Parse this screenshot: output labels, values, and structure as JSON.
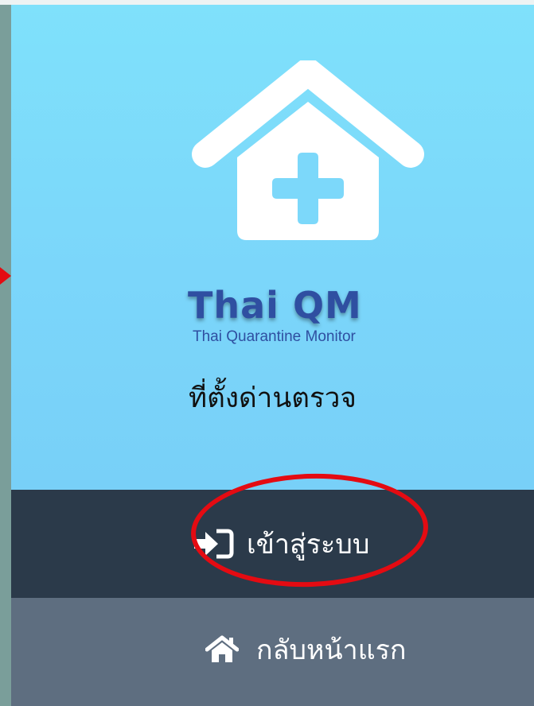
{
  "logo": {
    "title": "Thai QM",
    "subtitle": "Thai Quarantine Monitor"
  },
  "header": {
    "location_label": "ที่ตั้งด่านตรวจ"
  },
  "menu": {
    "login_label": "เข้าสู่ระบบ",
    "home_label": "กลับหน้าแรก"
  },
  "icons": {
    "header_icon": "house-medical-cross-icon",
    "login_icon": "sign-in-icon",
    "home_icon": "home-icon"
  },
  "colors": {
    "header_background": "#7bd6fa",
    "login_bar_background": "#2b3a4a",
    "home_bar_background": "#5e6e80",
    "logo_text": "#2f4fa1",
    "annotation_red": "#e40b12",
    "page_background": "#7a9e9a"
  }
}
